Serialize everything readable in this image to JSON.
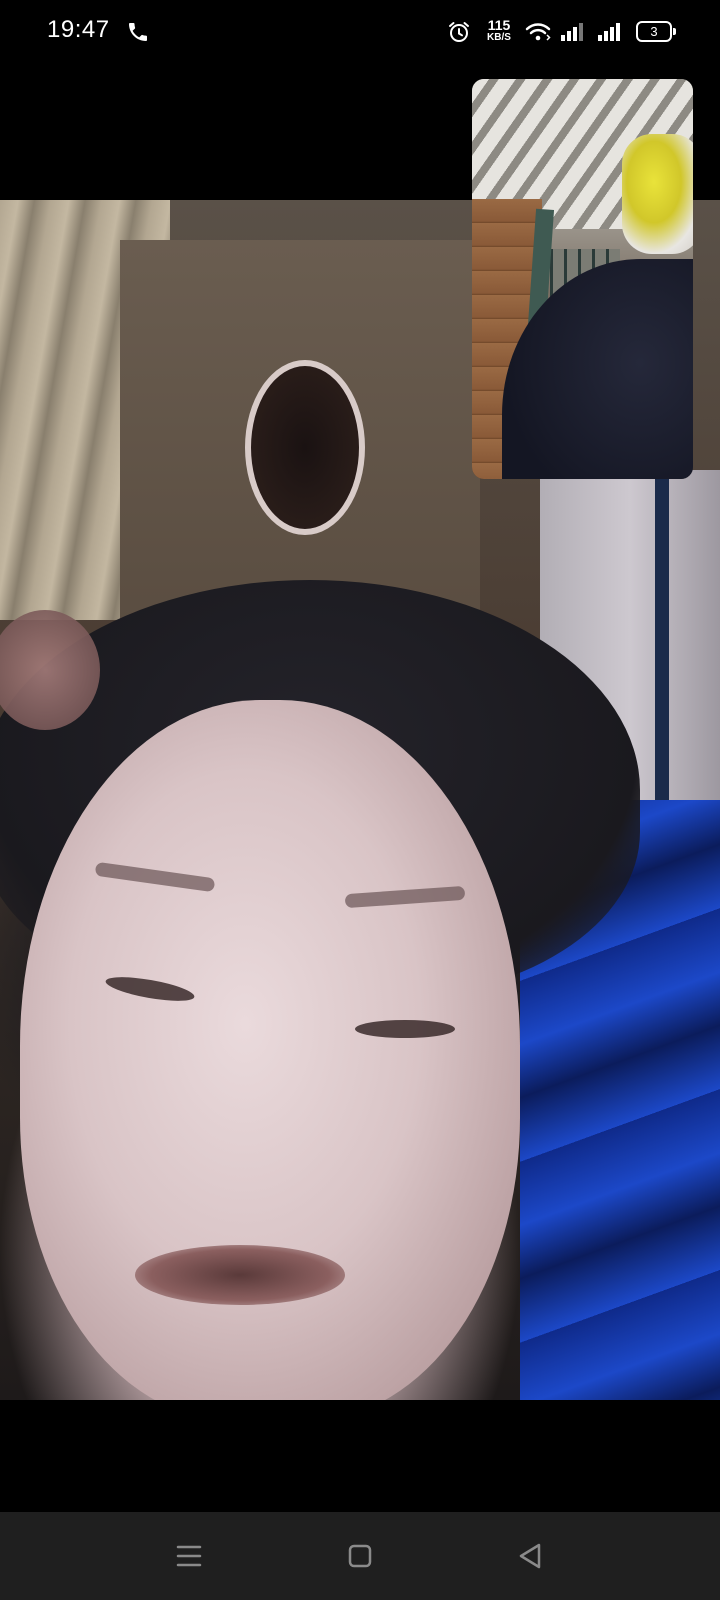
{
  "status_bar": {
    "time": "19:47",
    "net_speed_value": "115",
    "net_speed_unit": "KB/S",
    "battery_level": "3",
    "icons": [
      "call-icon",
      "alarm-icon",
      "wifi-icon",
      "signal-icon",
      "signal-icon",
      "battery-icon"
    ]
  },
  "call": {
    "remote_video": "remote-participant-video",
    "self_preview": "self-camera-preview"
  },
  "nav_bar": {
    "buttons": [
      "menu-icon",
      "home-icon",
      "back-icon"
    ]
  },
  "colors": {
    "background": "#000000",
    "nav_bar": "#1f1f1f",
    "status_text": "#ffffff"
  }
}
